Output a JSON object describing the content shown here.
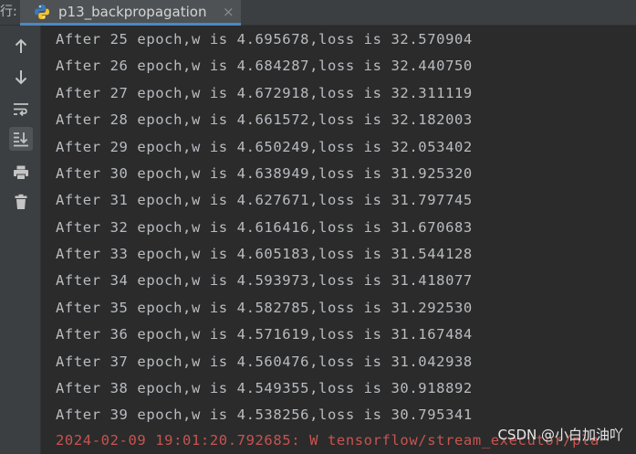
{
  "header": {
    "run_label": "行:",
    "tab": {
      "title": "p13_backpropagation",
      "close_glyph": "×",
      "icon": "python-icon"
    }
  },
  "toolbar": {
    "items": [
      {
        "name": "scroll-up",
        "icon": "arrow-up-icon"
      },
      {
        "name": "scroll-down",
        "icon": "arrow-down-icon"
      },
      {
        "name": "soft-wrap",
        "icon": "soft-wrap-icon"
      },
      {
        "name": "scroll-to-end",
        "icon": "scroll-to-end-icon",
        "active": true
      },
      {
        "name": "print",
        "icon": "printer-icon"
      },
      {
        "name": "clear",
        "icon": "trash-icon"
      }
    ]
  },
  "console": {
    "lines": [
      "After 25 epoch,w is 4.695678,loss is 32.570904",
      "After 26 epoch,w is 4.684287,loss is 32.440750",
      "After 27 epoch,w is 4.672918,loss is 32.311119",
      "After 28 epoch,w is 4.661572,loss is 32.182003",
      "After 29 epoch,w is 4.650249,loss is 32.053402",
      "After 30 epoch,w is 4.638949,loss is 31.925320",
      "After 31 epoch,w is 4.627671,loss is 31.797745",
      "After 32 epoch,w is 4.616416,loss is 31.670683",
      "After 33 epoch,w is 4.605183,loss is 31.544128",
      "After 34 epoch,w is 4.593973,loss is 31.418077",
      "After 35 epoch,w is 4.582785,loss is 31.292530",
      "After 36 epoch,w is 4.571619,loss is 31.167484",
      "After 37 epoch,w is 4.560476,loss is 31.042938",
      "After 38 epoch,w is 4.549355,loss is 30.918892",
      "After 39 epoch,w is 4.538256,loss is 30.795341"
    ],
    "error_line": "2024-02-09 19:01:20.792685: W tensorflow/stream_executor/pla"
  },
  "watermark": "CSDN @小白加油吖",
  "colors": {
    "background": "#2b2b2b",
    "text": "#b9bcc0",
    "error": "#c75450",
    "tab_accent": "#4a88c7"
  }
}
